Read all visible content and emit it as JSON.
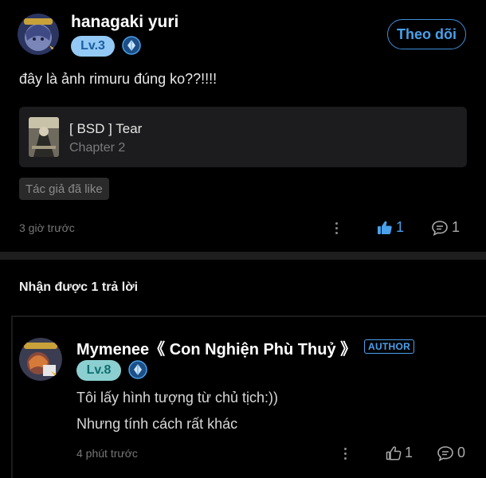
{
  "post": {
    "username": "hanagaki yuri",
    "level": "Lv.3",
    "follow_label": "Theo dõi",
    "text": "đây là ảnh rimuru đúng ko??!!!!",
    "reference": {
      "title": "[ BSD ] Tear",
      "subtitle": "Chapter 2"
    },
    "author_liked_tag": "Tác giả đã like",
    "time": "3 giờ trước",
    "like_count": "1",
    "comment_count": "1",
    "colors": {
      "accent": "#4aa0ec",
      "level_badge": "#93c9f4"
    }
  },
  "replies_header": "Nhận được 1 trả lời",
  "reply": {
    "username": "Mymenee《 Con Nghiện Phù Thuỷ 》",
    "author_badge": "AUTHOR",
    "level": "Lv.8",
    "lines": [
      "Tôi lấy hình tượng từ chủ tịch:))",
      "Nhưng tính cách rất khác"
    ],
    "time": "4 phút trước",
    "like_count": "1",
    "comment_count": "0",
    "colors": {
      "level_badge": "#8ccfd0"
    }
  },
  "icons": [
    "avatar",
    "rank-diamond-icon",
    "more-dots-icon",
    "thumb-up-icon",
    "comment-bubble-icon"
  ]
}
